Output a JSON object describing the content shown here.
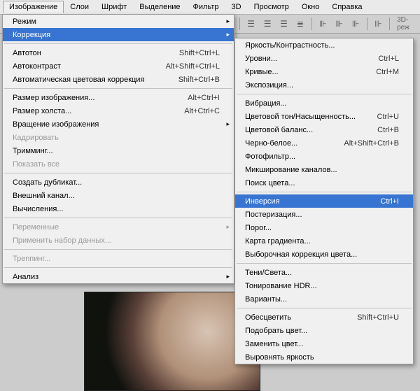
{
  "menubar": {
    "items": [
      "Изображение",
      "Слои",
      "Шрифт",
      "Выделение",
      "Фильтр",
      "3D",
      "Просмотр",
      "Окно",
      "Справка"
    ]
  },
  "toolbar": {
    "label3d": "3D-реж"
  },
  "dropdownImage": {
    "rows": [
      {
        "label": "Режим",
        "arrow": true
      },
      {
        "label": "Коррекция",
        "arrow": true,
        "hl": true
      },
      {
        "sep": true
      },
      {
        "label": "Автотон",
        "shortcut": "Shift+Ctrl+L"
      },
      {
        "label": "Автоконтраст",
        "shortcut": "Alt+Shift+Ctrl+L"
      },
      {
        "label": "Автоматическая цветовая коррекция",
        "shortcut": "Shift+Ctrl+B"
      },
      {
        "sep": true
      },
      {
        "label": "Размер изображения...",
        "shortcut": "Alt+Ctrl+I"
      },
      {
        "label": "Размер холста...",
        "shortcut": "Alt+Ctrl+C"
      },
      {
        "label": "Вращение изображения",
        "arrow": true
      },
      {
        "label": "Кадрировать",
        "disabled": true
      },
      {
        "label": "Тримминг..."
      },
      {
        "label": "Показать все",
        "disabled": true
      },
      {
        "sep": true
      },
      {
        "label": "Создать дубликат..."
      },
      {
        "label": "Внешний канал..."
      },
      {
        "label": "Вычисления..."
      },
      {
        "sep": true
      },
      {
        "label": "Переменные",
        "arrow": true,
        "disabled": true
      },
      {
        "label": "Применить набор данных...",
        "disabled": true
      },
      {
        "sep": true
      },
      {
        "label": "Треппинг...",
        "disabled": true
      },
      {
        "sep": true
      },
      {
        "label": "Анализ",
        "arrow": true
      }
    ]
  },
  "dropdownCorr": {
    "rows": [
      {
        "label": "Яркость/Контрастность..."
      },
      {
        "label": "Уровни...",
        "shortcut": "Ctrl+L"
      },
      {
        "label": "Кривые...",
        "shortcut": "Ctrl+M"
      },
      {
        "label": "Экспозиция..."
      },
      {
        "sep": true
      },
      {
        "label": "Вибрация..."
      },
      {
        "label": "Цветовой тон/Насыщенность...",
        "shortcut": "Ctrl+U"
      },
      {
        "label": "Цветовой баланс...",
        "shortcut": "Ctrl+B"
      },
      {
        "label": "Черно-белое...",
        "shortcut": "Alt+Shift+Ctrl+B"
      },
      {
        "label": "Фотофильтр..."
      },
      {
        "label": "Микширование каналов..."
      },
      {
        "label": "Поиск цвета..."
      },
      {
        "sep": true
      },
      {
        "label": "Инверсия",
        "shortcut": "Ctrl+I",
        "hl": true
      },
      {
        "label": "Постеризация..."
      },
      {
        "label": "Порог..."
      },
      {
        "label": "Карта градиента..."
      },
      {
        "label": "Выборочная коррекция цвета..."
      },
      {
        "sep": true
      },
      {
        "label": "Тени/Света..."
      },
      {
        "label": "Тонирование HDR..."
      },
      {
        "label": "Варианты..."
      },
      {
        "sep": true
      },
      {
        "label": "Обесцветить",
        "shortcut": "Shift+Ctrl+U"
      },
      {
        "label": "Подобрать цвет..."
      },
      {
        "label": "Заменить цвет..."
      },
      {
        "label": "Выровнять яркость"
      }
    ]
  }
}
